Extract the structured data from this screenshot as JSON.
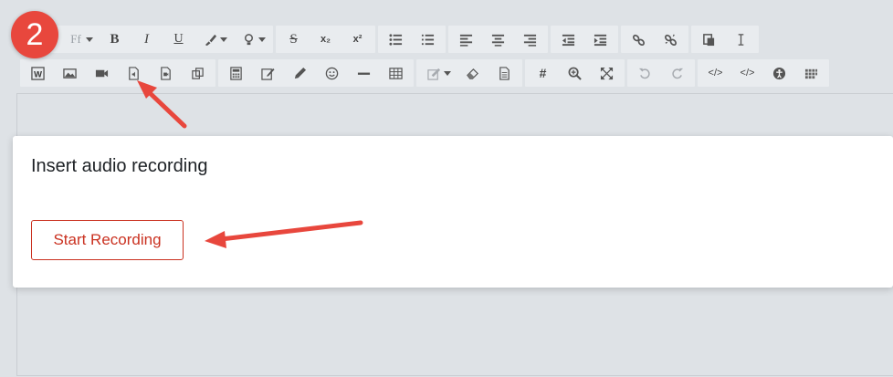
{
  "step_badge": "2",
  "toolbar": {
    "row1_groups": [
      [
        "info-icon",
        "font-family-icon",
        "bold-icon",
        "italic-icon",
        "underline-icon",
        "font-color-icon",
        "highlight-icon"
      ],
      [
        "strikethrough-icon",
        "subscript-icon",
        "superscript-icon"
      ],
      [
        "unordered-list-icon",
        "ordered-list-icon"
      ],
      [
        "align-left-icon",
        "align-center-icon",
        "align-right-icon"
      ],
      [
        "outdent-icon",
        "indent-icon"
      ],
      [
        "link-icon",
        "unlink-icon"
      ],
      [
        "paste-icon",
        "clear-formatting-icon"
      ]
    ],
    "row2_groups": [
      [
        "word-import-icon",
        "image-icon",
        "video-icon",
        "audio-recording-icon",
        "video-recording-icon",
        "copy-icon"
      ],
      [
        "calculator-icon",
        "edit-icon",
        "pencil-icon",
        "emoji-icon",
        "horizontal-rule-icon",
        "table-icon"
      ],
      [
        "form-icon",
        "eraser-icon",
        "document-icon"
      ],
      [
        "hashtag-icon",
        "zoom-icon",
        "fullscreen-icon"
      ],
      [
        "undo-icon",
        "redo-icon"
      ],
      [
        "html-icon",
        "code-icon",
        "accessibility-icon",
        "screenreader-icon"
      ]
    ]
  },
  "dialog": {
    "title": "Insert audio recording",
    "start_button": "Start Recording"
  },
  "colors": {
    "accent_red": "#ca3120",
    "annotation_red": "#e8473d",
    "toolbar_bg": "#e9ecef",
    "page_bg": "#dee2e6"
  }
}
